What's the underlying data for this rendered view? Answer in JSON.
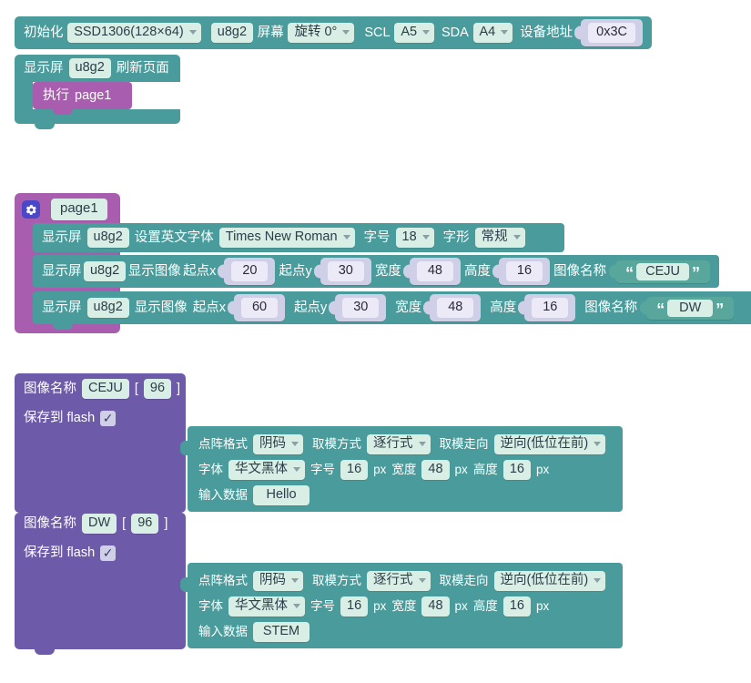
{
  "blocks": {
    "init": {
      "label": "初始化",
      "device": "SSD1306(128×64)",
      "object": "u8g2",
      "screen_label": "屏幕",
      "rotation": "旋转 0°",
      "scl_label": "SCL",
      "scl": "A5",
      "sda_label": "SDA",
      "sda": "A4",
      "addr_label": "设备地址",
      "addr": "0x3C"
    },
    "refresh": {
      "display_label": "显示屏",
      "object": "u8g2",
      "action": "刷新页面",
      "run_label": "执行",
      "run_target": "page1"
    },
    "page": {
      "name": "page1",
      "icon": "gear-icon",
      "font_row": {
        "display_label": "显示屏",
        "object": "u8g2",
        "action": "设置英文字体",
        "font": "Times New Roman",
        "size_label": "字号",
        "size": "18",
        "style_label": "字形",
        "style": "常规"
      },
      "image_rows": [
        {
          "display_label": "显示屏",
          "object": "u8g2",
          "action": "显示图像",
          "x_label": "起点x",
          "x": "20",
          "y_label": "起点y",
          "y": "30",
          "w_label": "宽度",
          "w": "48",
          "h_label": "高度",
          "h": "16",
          "name_label": "图像名称",
          "name": "CEJU"
        },
        {
          "display_label": "显示屏",
          "object": "u8g2",
          "action": "显示图像",
          "x_label": "起点x",
          "x": "60",
          "y_label": "起点y",
          "y": "30",
          "w_label": "宽度",
          "w": "48",
          "h_label": "高度",
          "h": "16",
          "name_label": "图像名称",
          "name": "DW"
        }
      ]
    },
    "images": [
      {
        "name_label": "图像名称",
        "name": "CEJU",
        "bracket_open": "[",
        "count": "96",
        "bracket_close": "]",
        "flash_label": "保存到 flash",
        "flash_checked": "✓",
        "params": {
          "dot_label": "点阵格式",
          "dot": "阴码",
          "mode_label": "取模方式",
          "mode": "逐行式",
          "dir_label": "取模走向",
          "dir": "逆向(低位在前)",
          "font_label": "字体",
          "font": "华文黑体",
          "size_label": "字号",
          "size": "16",
          "size_unit": "px",
          "w_label": "宽度",
          "w": "48",
          "w_unit": "px",
          "h_label": "高度",
          "h": "16",
          "h_unit": "px",
          "data_label": "输入数据",
          "data": "Hello"
        }
      },
      {
        "name_label": "图像名称",
        "name": "DW",
        "bracket_open": "[",
        "count": "96",
        "bracket_close": "]",
        "flash_label": "保存到 flash",
        "flash_checked": "✓",
        "params": {
          "dot_label": "点阵格式",
          "dot": "阴码",
          "mode_label": "取模方式",
          "mode": "逐行式",
          "dir_label": "取模走向",
          "dir": "逆向(低位在前)",
          "font_label": "字体",
          "font": "华文黑体",
          "size_label": "字号",
          "size": "16",
          "size_unit": "px",
          "w_label": "宽度",
          "w": "48",
          "w_unit": "px",
          "h_label": "高度",
          "h": "16",
          "h_unit": "px",
          "data_label": "输入数据",
          "data": "STEM"
        }
      }
    ]
  },
  "colors": {
    "teal": "#4a9c9c",
    "orchid": "#a95dae",
    "slate": "#6d5aa8",
    "chip": "#d9eee4",
    "num_chip": "#cfcfe8",
    "gear_bg": "#4a47c8",
    "canvas": "#ffffff"
  }
}
